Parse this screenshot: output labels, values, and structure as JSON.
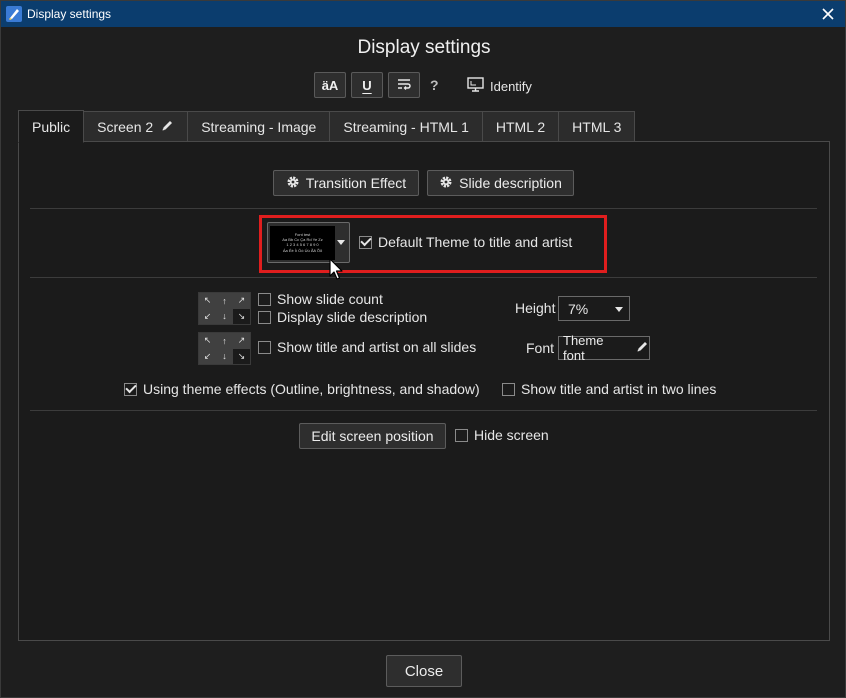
{
  "window": {
    "title": "Display settings"
  },
  "header": {
    "title": "Display settings",
    "toolbar": {
      "font_case_label": "äA",
      "underline_label": "U",
      "help_label": "?",
      "identify_label": "Identify"
    }
  },
  "tabs": [
    {
      "label": "Public",
      "active": true
    },
    {
      "label": "Screen 2",
      "active": false
    },
    {
      "label": "Streaming - Image",
      "active": false
    },
    {
      "label": "Streaming - HTML 1",
      "active": false
    },
    {
      "label": "HTML 2",
      "active": false
    },
    {
      "label": "HTML 3",
      "active": false
    }
  ],
  "public_tab": {
    "transition_effect_label": "Transition Effect",
    "slide_description_label": "Slide description",
    "theme_preview_lines": [
      "Font test",
      "Aa Bb Cc Ça Rd Ye Zz",
      "1 2 3 4 5 6 7 8 9 0",
      "Áa Éé Íí Óó Úú Ãã Õõ"
    ],
    "default_theme": {
      "label": "Default Theme to title and artist",
      "checked": true
    },
    "show_slide_count": {
      "label": "Show slide count",
      "checked": false
    },
    "display_slide_description": {
      "label": "Display slide description",
      "checked": false
    },
    "show_title_artist_all": {
      "label": "Show title and artist on all slides",
      "checked": false
    },
    "height": {
      "label": "Height",
      "value": "7%"
    },
    "font": {
      "label": "Font",
      "value": "Theme font"
    },
    "using_theme_effects": {
      "label": "Using theme effects (Outline, brightness, and shadow)",
      "checked": true
    },
    "title_artist_two_lines": {
      "label": "Show title and artist in two lines",
      "checked": false
    },
    "edit_screen_position_label": "Edit screen position",
    "hide_screen": {
      "label": "Hide screen",
      "checked": false
    }
  },
  "footer": {
    "close_label": "Close"
  },
  "colors": {
    "titlebar": "#0b3d6e",
    "highlight": "#e01e1e",
    "background": "#1b1b1b"
  }
}
